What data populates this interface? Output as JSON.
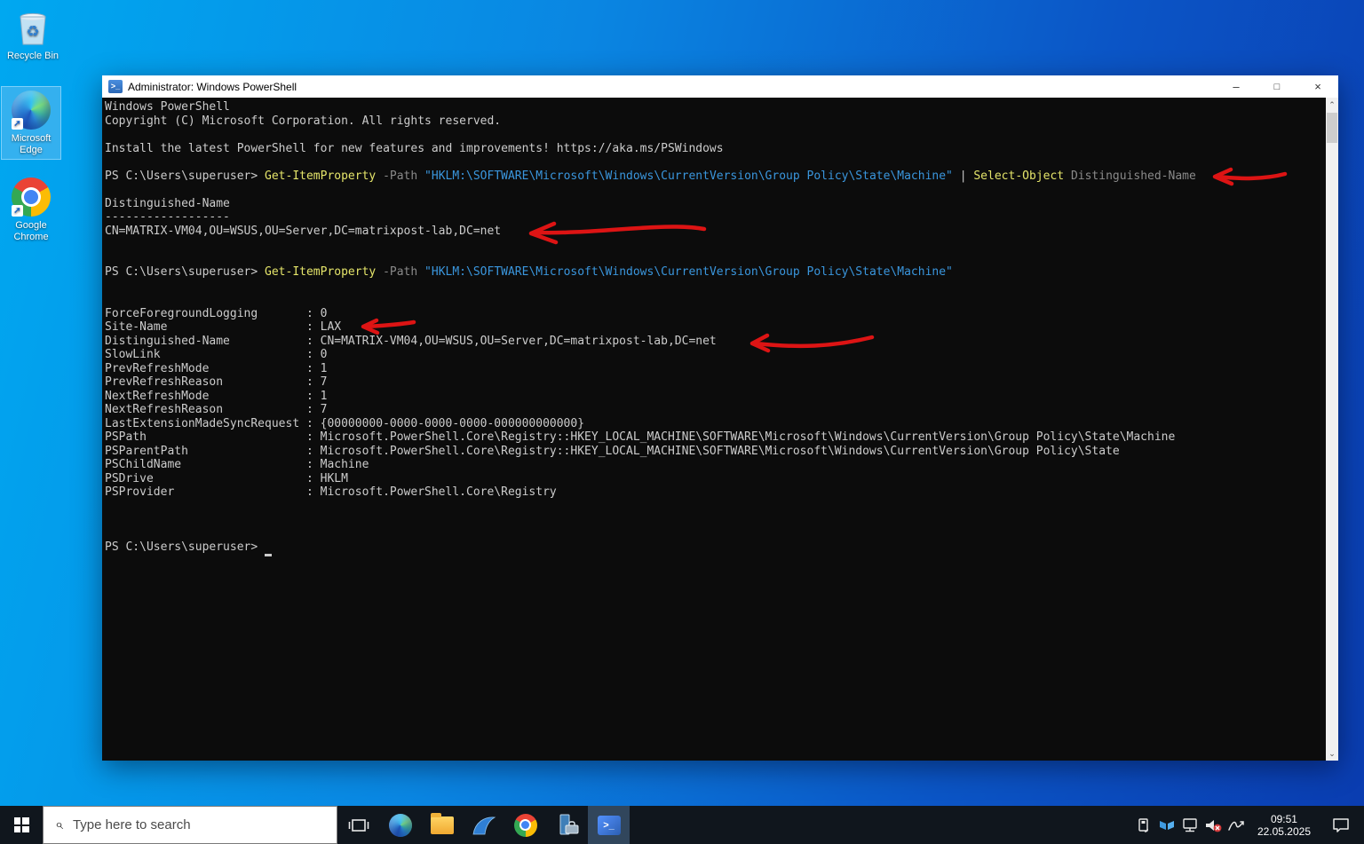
{
  "colors": {
    "desktop_left": "#00a8f0",
    "desktop_right": "#0a3cb0",
    "console_bg": "#0c0c0c",
    "text_default": "#cccccc",
    "text_command": "#e5e56a",
    "text_parameter": "#8a8a8a",
    "text_string": "#3a96dd",
    "annotation_red": "#dd1414",
    "taskbar_bg": "#10161d",
    "titlebar_bg": "#ffffff",
    "active_app_bg": "#31465c"
  },
  "desktop": {
    "icons": [
      {
        "label": "Recycle Bin"
      },
      {
        "label": "Microsoft Edge",
        "selected": true
      },
      {
        "label": "Google Chrome"
      }
    ]
  },
  "window": {
    "title": "Administrator: Windows PowerShell",
    "controls": {
      "minimize": "–",
      "maximize": "□",
      "close": "×"
    }
  },
  "console": {
    "lines": [
      [
        [
          "Windows PowerShell",
          "d"
        ]
      ],
      [
        [
          "Copyright (C) Microsoft Corporation. All rights reserved.",
          "d"
        ]
      ],
      [],
      [
        [
          "Install the latest PowerShell for new features and improvements! https://aka.ms/PSWindows",
          "d"
        ]
      ],
      [],
      [
        [
          "PS C:\\Users\\superuser> ",
          "d"
        ],
        [
          "Get-ItemProperty ",
          "c"
        ],
        [
          "-Path ",
          "p"
        ],
        [
          "\"HKLM:\\SOFTWARE\\Microsoft\\Windows\\CurrentVersion\\Group Policy\\State\\Machine\"",
          "s"
        ],
        [
          " | ",
          "d"
        ],
        [
          "Select-Object ",
          "c"
        ],
        [
          "Distinguished-Name",
          "p"
        ]
      ],
      [],
      [
        [
          "Distinguished-Name",
          "d"
        ]
      ],
      [
        [
          "------------------",
          "d"
        ]
      ],
      [
        [
          "CN=MATRIX-VM04,OU=WSUS,OU=Server,DC=matrixpost-lab,DC=net",
          "d"
        ]
      ],
      [],
      [],
      [
        [
          "PS C:\\Users\\superuser> ",
          "d"
        ],
        [
          "Get-ItemProperty ",
          "c"
        ],
        [
          "-Path ",
          "p"
        ],
        [
          "\"HKLM:\\SOFTWARE\\Microsoft\\Windows\\CurrentVersion\\Group Policy\\State\\Machine\"",
          "s"
        ]
      ],
      [],
      [],
      [
        [
          "ForceForegroundLogging       : 0",
          "d"
        ]
      ],
      [
        [
          "Site-Name                    : LAX",
          "d"
        ]
      ],
      [
        [
          "Distinguished-Name           : CN=MATRIX-VM04,OU=WSUS,OU=Server,DC=matrixpost-lab,DC=net",
          "d"
        ]
      ],
      [
        [
          "SlowLink                     : 0",
          "d"
        ]
      ],
      [
        [
          "PrevRefreshMode              : 1",
          "d"
        ]
      ],
      [
        [
          "PrevRefreshReason            : 7",
          "d"
        ]
      ],
      [
        [
          "NextRefreshMode              : 1",
          "d"
        ]
      ],
      [
        [
          "NextRefreshReason            : 7",
          "d"
        ]
      ],
      [
        [
          "LastExtensionMadeSyncRequest : {00000000-0000-0000-0000-000000000000}",
          "d"
        ]
      ],
      [
        [
          "PSPath                       : Microsoft.PowerShell.Core\\Registry::HKEY_LOCAL_MACHINE\\SOFTWARE\\Microsoft\\Windows\\CurrentVersion\\Group Policy\\State\\Machine",
          "d"
        ]
      ],
      [
        [
          "PSParentPath                 : Microsoft.PowerShell.Core\\Registry::HKEY_LOCAL_MACHINE\\SOFTWARE\\Microsoft\\Windows\\CurrentVersion\\Group Policy\\State",
          "d"
        ]
      ],
      [
        [
          "PSChildName                  : Machine",
          "d"
        ]
      ],
      [
        [
          "PSDrive                      : HKLM",
          "d"
        ]
      ],
      [
        [
          "PSProvider                   : Microsoft.PowerShell.Core\\Registry",
          "d"
        ]
      ],
      [],
      [],
      [],
      [
        [
          "PS C:\\Users\\superuser> ",
          "d"
        ],
        [
          "_",
          "cur"
        ]
      ]
    ]
  },
  "taskbar": {
    "search": {
      "placeholder": "Type here to search"
    },
    "apps": [
      {
        "name": "task-view"
      },
      {
        "name": "microsoft-edge"
      },
      {
        "name": "file-explorer"
      },
      {
        "name": "wireshark"
      },
      {
        "name": "google-chrome"
      },
      {
        "name": "server-manager"
      },
      {
        "name": "windows-powershell",
        "active": true
      }
    ],
    "tray": [
      {
        "name": "usb-device"
      },
      {
        "name": "network-share"
      },
      {
        "name": "network-status"
      },
      {
        "name": "volume-muted"
      },
      {
        "name": "ink-workspace"
      }
    ],
    "clock": {
      "time": "09:51",
      "date": "22.05.2025"
    }
  }
}
